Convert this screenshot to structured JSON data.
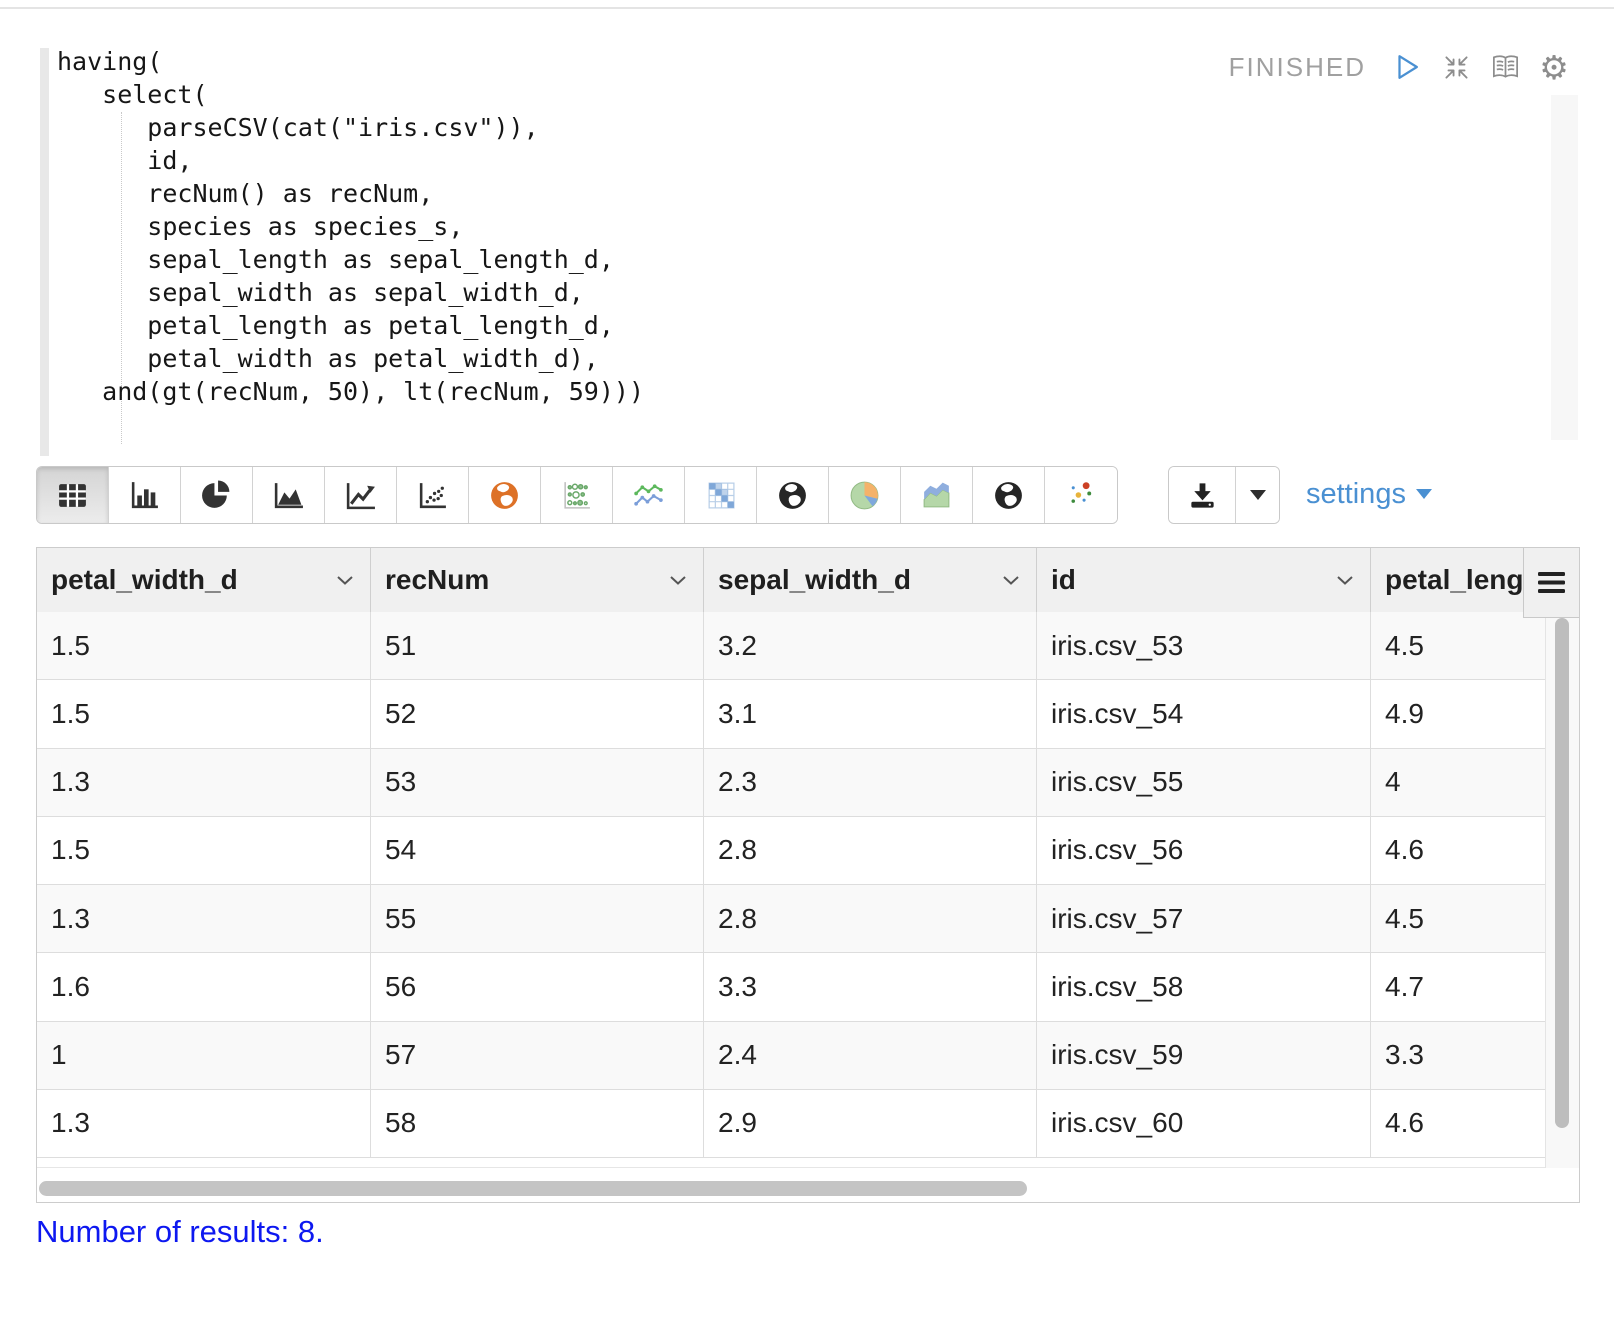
{
  "paragraph": {
    "status": "FINISHED",
    "controls": [
      {
        "icon": "play-icon"
      },
      {
        "icon": "compress-icon"
      },
      {
        "icon": "book-icon"
      },
      {
        "icon": "gear-icon"
      }
    ]
  },
  "editor": {
    "code": "having(\n   select(\n      parseCSV(cat(\"iris.csv\")),\n      id,\n      recNum() as recNum,\n      species as species_s,\n      sepal_length as sepal_length_d,\n      sepal_width as sepal_width_d,\n      petal_length as petal_length_d,\n      petal_width as petal_width_d),\n   and(gt(recNum, 50), lt(recNum, 59)))"
  },
  "toolbar": {
    "chart_buttons": [
      {
        "name": "table-view",
        "icon": "i-table",
        "active": true
      },
      {
        "name": "bar-chart",
        "icon": "i-bar",
        "active": false
      },
      {
        "name": "pie-chart",
        "icon": "i-pie",
        "active": false
      },
      {
        "name": "area-chart",
        "icon": "i-area",
        "active": false
      },
      {
        "name": "line-chart",
        "icon": "i-line",
        "active": false
      },
      {
        "name": "scatter-plot",
        "icon": "i-scatter",
        "active": false
      },
      {
        "name": "globe-orange",
        "icon": "i-globe-orange",
        "active": false
      },
      {
        "name": "bubble-grid",
        "icon": "i-bubblegrid",
        "active": false
      },
      {
        "name": "multi-line-chart",
        "icon": "i-multiline",
        "active": false
      },
      {
        "name": "heatmap",
        "icon": "i-heatmap",
        "active": false
      },
      {
        "name": "globe-dark",
        "icon": "i-globe-dark",
        "active": false
      },
      {
        "name": "pie-pastel",
        "icon": "i-pie-pastel",
        "active": false
      },
      {
        "name": "area-pastel",
        "icon": "i-area-pastel",
        "active": false
      },
      {
        "name": "globe-dark-2",
        "icon": "i-globe-dark",
        "active": false
      },
      {
        "name": "bubble-scatter",
        "icon": "i-bubble-color",
        "active": false
      }
    ],
    "download_icon": "download-icon",
    "settings_label": "settings"
  },
  "table": {
    "columns": [
      {
        "label": "petal_width_d",
        "menu": true
      },
      {
        "label": "recNum",
        "menu": true
      },
      {
        "label": "sepal_width_d",
        "menu": true
      },
      {
        "label": "id",
        "menu": true
      },
      {
        "label": "petal_leng",
        "menu": false
      }
    ],
    "rows": [
      [
        "1.5",
        "51",
        "3.2",
        "iris.csv_53",
        "4.5"
      ],
      [
        "1.5",
        "52",
        "3.1",
        "iris.csv_54",
        "4.9"
      ],
      [
        "1.3",
        "53",
        "2.3",
        "iris.csv_55",
        "4"
      ],
      [
        "1.5",
        "54",
        "2.8",
        "iris.csv_56",
        "4.6"
      ],
      [
        "1.3",
        "55",
        "2.8",
        "iris.csv_57",
        "4.5"
      ],
      [
        "1.6",
        "56",
        "3.3",
        "iris.csv_58",
        "4.7"
      ],
      [
        "1",
        "57",
        "2.4",
        "iris.csv_59",
        "3.3"
      ],
      [
        "1.3",
        "58",
        "2.9",
        "iris.csv_60",
        "4.6"
      ]
    ]
  },
  "footer": {
    "results_text": "Number of results: 8."
  }
}
